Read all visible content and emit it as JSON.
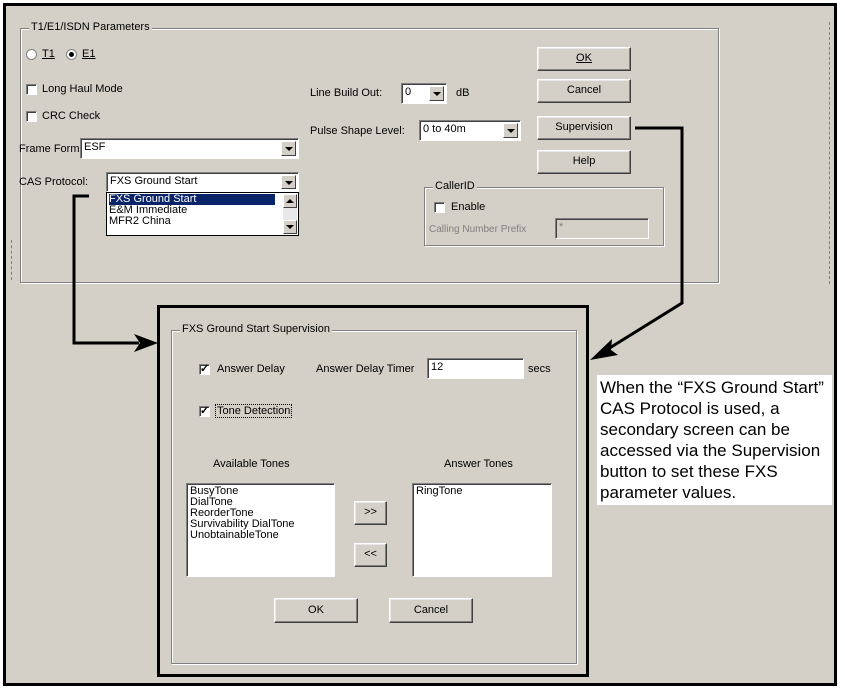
{
  "params_group": {
    "title": "T1/E1/ISDN Parameters",
    "radio_t1": "T1",
    "radio_e1": "E1",
    "long_haul": "Long Haul Mode",
    "crc_check": "CRC Check",
    "frame_format_label": "Frame Format:",
    "frame_format_value": "ESF",
    "cas_protocol_label": "CAS Protocol:",
    "cas_protocol_value": "FXS Ground Start",
    "cas_options": [
      "FXS Ground Start",
      "E&M Immediate",
      "MFR2 China"
    ],
    "line_build_out_label": "Line Build Out:",
    "line_build_out_value": "0",
    "line_build_out_unit": "dB",
    "pulse_shape_label": "Pulse Shape Level:",
    "pulse_shape_value": "0 to 40m"
  },
  "buttons": {
    "ok": "OK",
    "cancel": "Cancel",
    "supervision": "Supervision",
    "help": "Help"
  },
  "callerid": {
    "title": "CallerID",
    "enable": "Enable",
    "prefix_label": "Calling Number Prefix",
    "prefix_value": "*"
  },
  "supervision_dialog": {
    "title": "FXS Ground Start Supervision",
    "answer_delay": "Answer Delay",
    "answer_delay_timer_label": "Answer Delay Timer",
    "answer_delay_timer_value": "12",
    "secs": "secs",
    "tone_detection": "Tone Detection",
    "available_tones_label": "Available Tones",
    "available_tones": [
      "BusyTone",
      "DialTone",
      "ReorderTone",
      "Survivability DialTone",
      "UnobtainableTone"
    ],
    "answer_tones_label": "Answer Tones",
    "answer_tones": [
      "RingTone"
    ],
    "add_button": ">>",
    "remove_button": "<<",
    "ok": "OK",
    "cancel": "Cancel"
  },
  "note": "When the “FXS Ground Start” CAS Protocol is used, a secondary screen can be accessed via the Supervision button to set these FXS parameter values."
}
